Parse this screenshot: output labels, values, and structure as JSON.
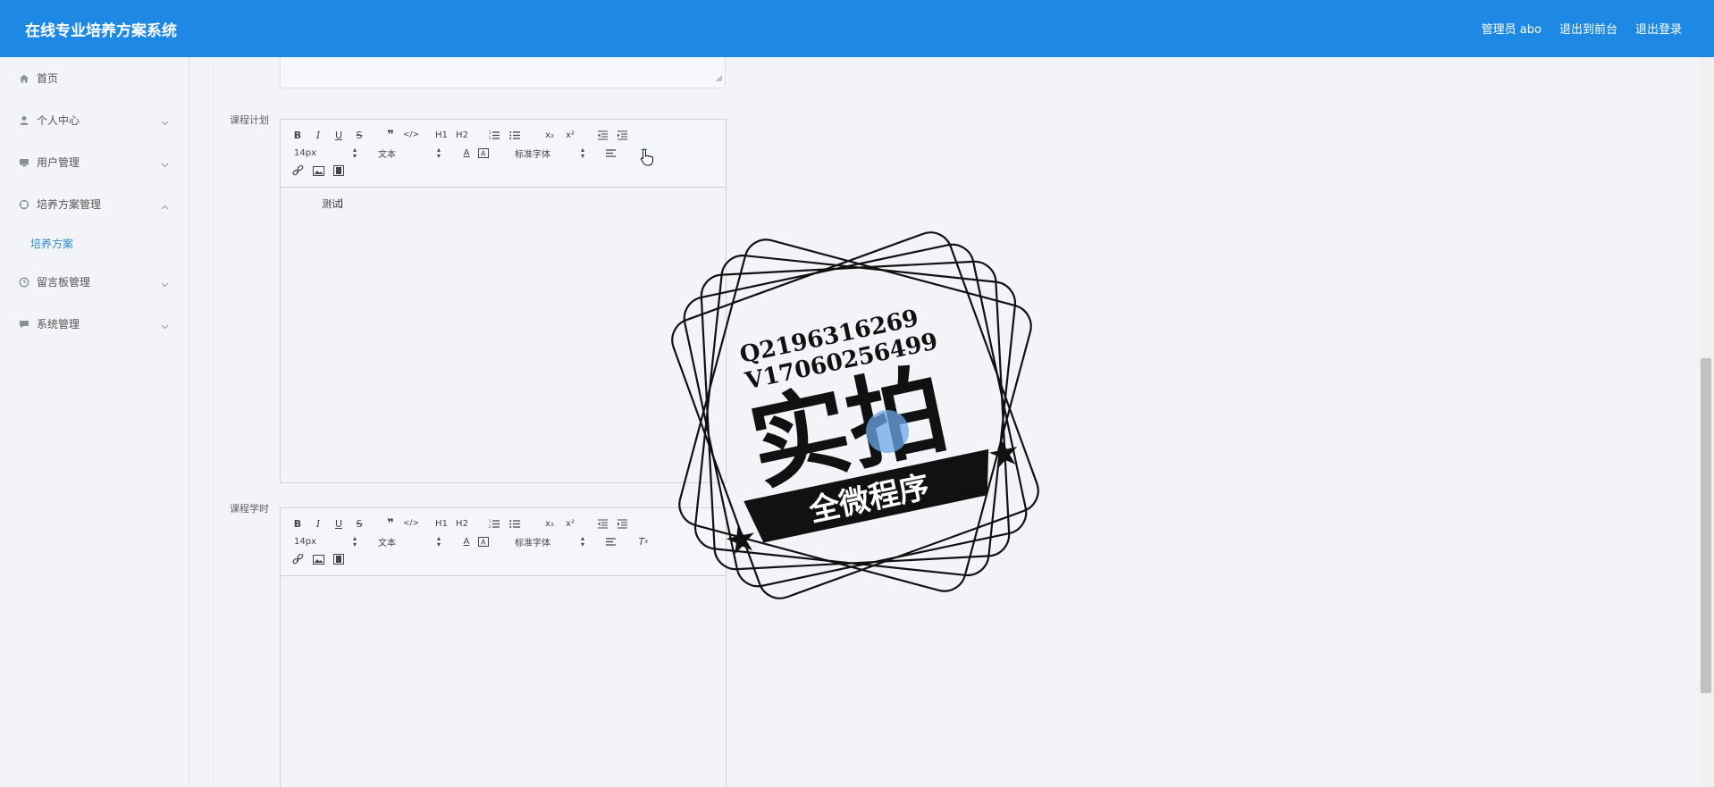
{
  "header": {
    "title": "在线专业培养方案系统",
    "nav": [
      "管理员 abo",
      "退出到前台",
      "退出登录"
    ]
  },
  "sidebar": {
    "items": [
      {
        "label": "首页",
        "icon": "home-icon"
      },
      {
        "label": "个人中心",
        "icon": "person-icon"
      },
      {
        "label": "用户管理",
        "icon": "monitor-icon"
      },
      {
        "label": "培养方案管理",
        "icon": "target-icon",
        "expanded": true
      },
      {
        "label": "留言板管理",
        "icon": "clock-icon"
      },
      {
        "label": "系统管理",
        "icon": "chat-icon"
      }
    ],
    "submenu": {
      "label": "培养方案"
    }
  },
  "form": {
    "field1_label": "课程计划",
    "field2_label": "课程学时",
    "field1_content": "测试"
  },
  "toolbar": {
    "size": "14px",
    "header": "文本",
    "font": "标准字体",
    "h1": "H1",
    "h2": "H2",
    "sub": "x₂",
    "sup": "x²"
  },
  "stamp": {
    "line1": "Q2196316269",
    "line2": "V17060256499",
    "big": "实拍",
    "banner": "全微程序"
  },
  "colors": {
    "accent": "#1e88e5",
    "active_submenu": "#2b8ed2"
  }
}
